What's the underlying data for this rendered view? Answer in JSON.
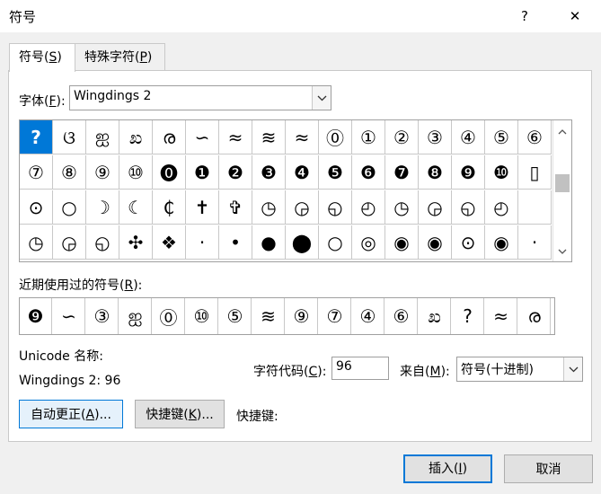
{
  "window": {
    "title": "符号",
    "help": "?",
    "close": "✕"
  },
  "tabs": [
    {
      "label": "符号(",
      "key": "S",
      "suffix": ")"
    },
    {
      "label": "特殊字符(",
      "key": "P",
      "suffix": ")"
    }
  ],
  "font": {
    "label": "字体(",
    "key": "F",
    "suffix": "):",
    "value": "Wingdings 2"
  },
  "symbol_grid": [
    [
      "?",
      "ଓ",
      "ஐ",
      "ಖ",
      "ര",
      "∽",
      "≈",
      "≋",
      "≈",
      "⓪",
      "①",
      "②",
      "③",
      "④",
      "⑤",
      "⑥"
    ],
    [
      "⑦",
      "⑧",
      "⑨",
      "⑩",
      "⓿",
      "❶",
      "❷",
      "❸",
      "❹",
      "❺",
      "❻",
      "❼",
      "❽",
      "❾",
      "❿",
      "▯"
    ],
    [
      "⊙",
      "○",
      "☽",
      "☾",
      "₵",
      "✝",
      "✞",
      "◷",
      "◶",
      "◵",
      "◴",
      "◷",
      "◶",
      "◵",
      "◴",
      ""
    ],
    [
      "◷",
      "◶",
      "◵",
      "✣",
      "❖",
      "·",
      "•",
      "●",
      "⬤",
      "○",
      "◎",
      "◉",
      "◉",
      "⊙",
      "◉",
      "·"
    ]
  ],
  "selected_index": 0,
  "recent": {
    "label": "近期使用过的符号(",
    "key": "R",
    "suffix": "):",
    "symbols": [
      "❾",
      "∽",
      "③",
      "ஐ",
      "⓪",
      "⑩",
      "⑤",
      "≋",
      "⑨",
      "⑦",
      "④",
      "⑥",
      "ಖ",
      "?",
      "≈",
      "ര"
    ]
  },
  "unicode_name_label": "Unicode 名称:",
  "unicode_name_value": "Wingdings 2: 96",
  "char_code": {
    "label": "字符代码(",
    "key": "C",
    "suffix": "):",
    "value": "96"
  },
  "from": {
    "label": "来自(",
    "key": "M",
    "suffix": "):",
    "value": "符号(十进制)"
  },
  "buttons": {
    "autocorrect": {
      "label": "自动更正(",
      "key": "A",
      "suffix": ")..."
    },
    "shortcut_key": {
      "label": "快捷键(",
      "key": "K",
      "suffix": ")..."
    },
    "shortcut_text": "快捷键:",
    "insert": {
      "label": "插入(",
      "key": "I",
      "suffix": ")"
    },
    "cancel": "取消"
  }
}
